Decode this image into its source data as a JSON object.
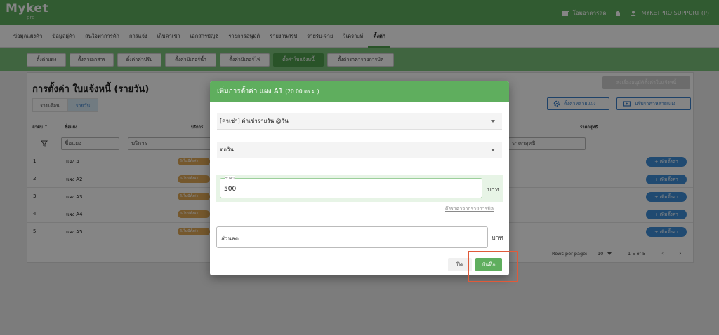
{
  "app": {
    "logo": "Myket",
    "logo_sub": "pro"
  },
  "header": {
    "branch": "โอมอาคารสด",
    "user": "MYKETPRO SUPPORT (P)"
  },
  "menu": [
    "ข้อมูลแผงค้า",
    "ข้อมูลผู้ค้า",
    "สนใจทำการค้า",
    "การแจ้ง",
    "เก็บค่าเช่า",
    "เอกสารบัญชี",
    "รายการอนุมัติ",
    "รายงานสรุป",
    "รายรับ-จ่าย",
    "วิเคราะห์",
    "ตั้งค่า"
  ],
  "subtabs": [
    "ตั้งค่าแผง",
    "ตั้งค่าเอกสาร",
    "ตั้งค่าค่าปรับ",
    "ตั้งค่ามิเตอร์น้ำ",
    "ตั้งค่ามิเตอร์ไฟ",
    "ตั้งค่าใบแจ้งหนี้",
    "ตั้งค่าราคารายการบิล"
  ],
  "page": {
    "title": "การตั้งค่า ใบแจ้งหนี้ (รายวัน)",
    "toggle_monthly": "รายเดือน",
    "toggle_daily": "รายวัน",
    "btn_approve_all": "ส่งเรื่องอนุมัติตั้งค่าใบแจ้งหนี้",
    "btn_settings_multi": "ตั้งค่าหลายแผง",
    "btn_price_multi": "ปรับราคาหลายแผง"
  },
  "table": {
    "columns": {
      "no": "ลำดับ ↑",
      "name": "ชื่อแผง",
      "service": "บริการ",
      "net": "ราคาสุทธิ"
    },
    "filter": {
      "name": "ชื่อแผง",
      "service": "บริการ",
      "net": "ราคาสุทธิ"
    },
    "rows": [
      {
        "no": "1",
        "name": "แผง A1",
        "status": "ยังไม่มีตั้งค่า",
        "action": "+ เพิ่มตั้งค่า"
      },
      {
        "no": "2",
        "name": "แผง A2",
        "status": "ยังไม่มีตั้งค่า",
        "action": "+ เพิ่มตั้งค่า"
      },
      {
        "no": "3",
        "name": "แผง A3",
        "status": "ยังไม่มีตั้งค่า",
        "action": "+ เพิ่มตั้งค่า"
      },
      {
        "no": "4",
        "name": "แผง A4",
        "status": "ยังไม่มีตั้งค่า",
        "action": "+ เพิ่มตั้งค่า"
      },
      {
        "no": "5",
        "name": "แผง A5",
        "status": "ยังไม่มีตั้งค่า",
        "action": "+ เพิ่มตั้งค่า"
      }
    ],
    "pagination": {
      "rows_label": "Rows per page:",
      "rows_value": "10",
      "range": "1-5 of 5"
    }
  },
  "dialog": {
    "title": "เพิ่มการตั้งค่า แผง A1",
    "size": "(20.00 ตร.ม.)",
    "service_value": "[ค่าเช่า] ค่าเช่ารายวัน @วัน",
    "period_value": "ต่อวัน",
    "price_label": "ราคา",
    "price_value": "500",
    "unit": "บาท",
    "link": "ดึงราคาจากรายการบิล",
    "discount_placeholder": "ส่วนลด",
    "close_label": "ปิด",
    "save_label": "บันทึก"
  },
  "colors": {
    "brand": "#5fae5e",
    "highlight": "#e05a3a",
    "action": "#3e8fd8",
    "badge": "#e0a957"
  }
}
